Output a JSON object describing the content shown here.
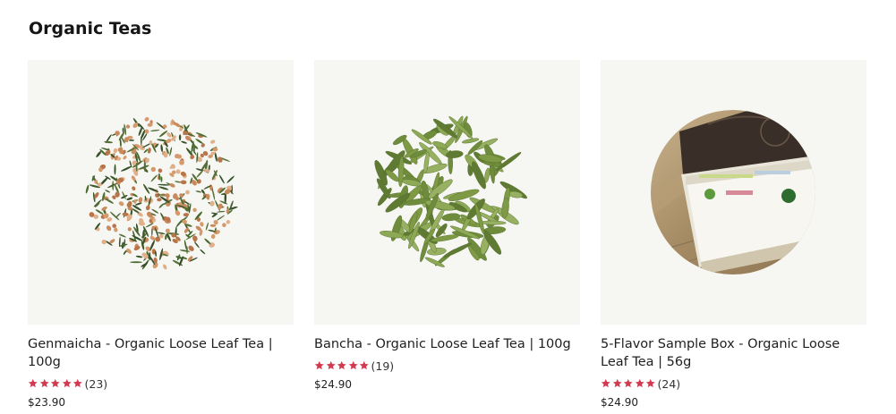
{
  "section": {
    "title": "Organic Teas"
  },
  "colors": {
    "star": "#d23b4f",
    "thumb_bg": "#f6f6f2"
  },
  "products": [
    {
      "name": "Genmaicha - Organic Loose Leaf Tea | 100g",
      "rating": 5,
      "review_count": "(23)",
      "price": "$23.90",
      "image_icon": "genmaicha-tea-leaves-image"
    },
    {
      "name": "Bancha - Organic Loose Leaf Tea | 100g",
      "rating": 5,
      "review_count": "(19)",
      "price": "$24.90",
      "image_icon": "bancha-tea-leaves-image"
    },
    {
      "name": "5-Flavor Sample Box - Organic Loose Leaf Tea | 56g",
      "rating": 5,
      "review_count": "(24)",
      "price": "$24.90",
      "image_icon": "sample-box-image"
    }
  ]
}
